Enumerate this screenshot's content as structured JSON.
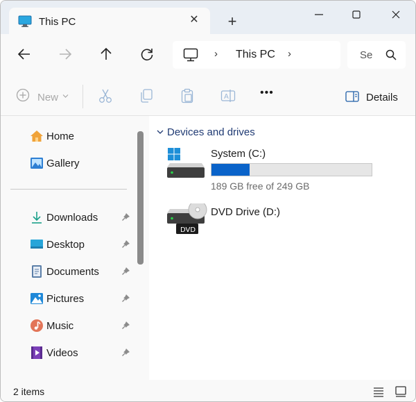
{
  "window": {
    "tab_title": "This PC",
    "tab_icon": "monitor-icon",
    "close_tab_glyph": "✕",
    "new_tab_glyph": "+",
    "minimize_glyph": "—",
    "maximize_glyph": "☐",
    "close_glyph": "✕"
  },
  "navigation": {
    "back_icon": "arrow-left-icon",
    "forward_icon": "arrow-right-icon",
    "up_icon": "arrow-up-icon",
    "refresh_icon": "refresh-icon",
    "address": {
      "location_icon": "monitor-icon",
      "separator": "›",
      "path": "This PC"
    },
    "search": {
      "placeholder_visible": "Se",
      "icon": "search-icon"
    }
  },
  "command_bar": {
    "new_label": "New",
    "new_chevron": "⌄",
    "cut_icon": "scissors-icon",
    "copy_icon": "copy-icon",
    "paste_icon": "paste-icon",
    "rename_icon": "rename-icon",
    "more_glyph": "•••",
    "details_label": "Details",
    "details_icon": "details-pane-icon"
  },
  "sidebar": {
    "items": [
      {
        "label": "Home",
        "icon": "home-icon",
        "pinned": false
      },
      {
        "label": "Gallery",
        "icon": "gallery-icon",
        "pinned": false
      },
      {
        "label": "Downloads",
        "icon": "download-icon",
        "pinned": true
      },
      {
        "label": "Desktop",
        "icon": "desktop-icon",
        "pinned": true
      },
      {
        "label": "Documents",
        "icon": "documents-icon",
        "pinned": true
      },
      {
        "label": "Pictures",
        "icon": "pictures-icon",
        "pinned": true
      },
      {
        "label": "Music",
        "icon": "music-icon",
        "pinned": true
      },
      {
        "label": "Videos",
        "icon": "videos-icon",
        "pinned": true
      }
    ]
  },
  "content": {
    "group_header": "Devices and drives",
    "drives": [
      {
        "name": "System (C:)",
        "icon": "system-drive-icon",
        "used_fraction": 0.24,
        "free_text": "189 GB free of 249 GB"
      },
      {
        "name": "DVD Drive (D:)",
        "icon": "dvd-drive-icon",
        "badge": "DVD"
      }
    ]
  },
  "status_bar": {
    "item_count": "2 items",
    "details_view_icon": "list-view-icon",
    "tiles_view_icon": "tiles-view-icon"
  },
  "colors": {
    "accent": "#0a63c9",
    "group_header": "#1f3a73",
    "titlebar_bg": "#e9eef4",
    "chrome_bg": "#f9f9f9"
  }
}
